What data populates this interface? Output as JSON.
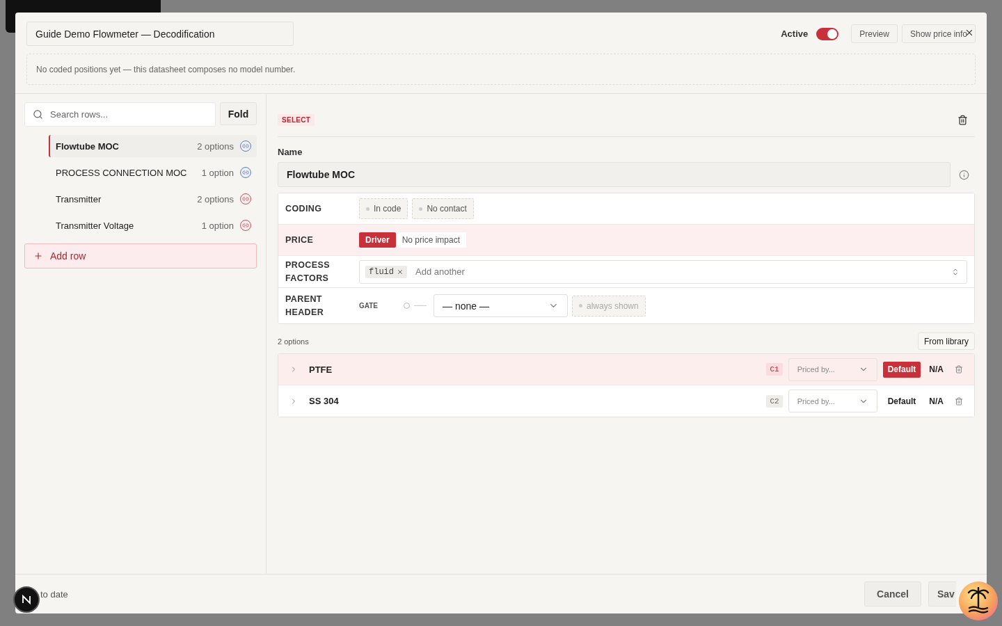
{
  "header": {
    "title": "Guide Demo Flowmeter — Decodification",
    "active": {
      "label": "Active",
      "on": true
    },
    "buttons": [
      "Preview",
      "Show price info"
    ]
  },
  "notice": "No coded positions yet — this datasheet composes no model number.",
  "sidebar": {
    "search": {
      "placeholder": "Search rows..."
    },
    "fold": "Fold",
    "rows": [
      {
        "name": "Flowtube MOC",
        "count": "2 options",
        "selected": true,
        "color": "#5b7fc4"
      },
      {
        "name": "PROCESS CONNECTION MOC",
        "count": "1 option",
        "selected": false,
        "color": "#5b7fc4"
      },
      {
        "name": "Transmitter",
        "count": "2 options",
        "selected": false,
        "color": "#d0505a"
      },
      {
        "name": "Transmitter Voltage",
        "count": "1 option",
        "selected": false,
        "color": "#d0505a"
      }
    ],
    "add_row": "Add row"
  },
  "editor": {
    "type_tag": "SELECT",
    "name_label": "Name",
    "name_value": "Flowtube MOC",
    "coding": {
      "label": "CODING",
      "chips": [
        "In code",
        "No contact"
      ]
    },
    "price": {
      "label": "PRICE",
      "choices": [
        {
          "label": "Driver",
          "selected": true
        },
        {
          "label": "No price impact",
          "selected": false
        }
      ]
    },
    "process_factors": {
      "label": "PROCESS FACTORS",
      "tags": [
        "fluid"
      ],
      "placeholder": "Add another"
    },
    "parent_header": {
      "label": "PARENT HEADER",
      "gate": "GATE",
      "select": "— none —",
      "chip": "always shown"
    }
  },
  "options": {
    "count": "2 options",
    "from_library": "From library",
    "items": [
      {
        "name": "PTFE",
        "code": "C1",
        "priced_placeholder": "Priced by...",
        "default": "Default",
        "selected": true,
        "price": "N/A"
      },
      {
        "name": "SS 304",
        "code": "C2",
        "priced_placeholder": "Priced by...",
        "default": "Default",
        "selected": false,
        "price": "N/A"
      }
    ]
  },
  "footer": {
    "status": "to date",
    "cancel": "Cancel",
    "save": "Sav"
  }
}
